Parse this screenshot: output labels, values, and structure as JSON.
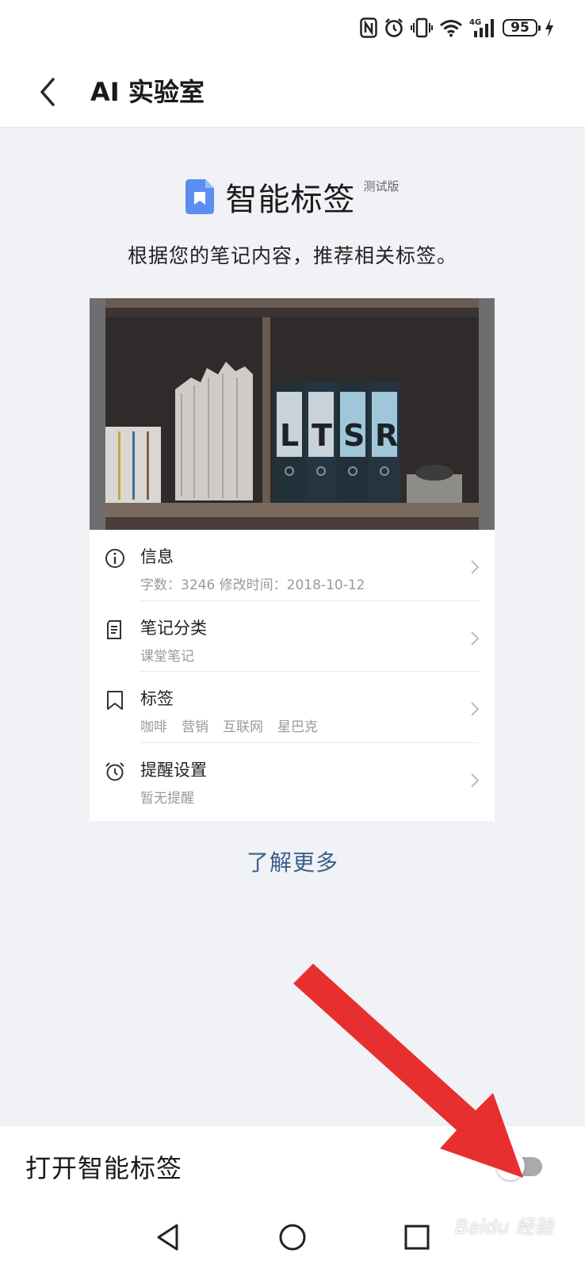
{
  "status_bar": {
    "icons": [
      "nfc-icon",
      "alarm-icon",
      "vibrate-icon",
      "wifi-icon",
      "signal-4g-icon",
      "battery-icon",
      "charging-icon"
    ],
    "network_label": "4G",
    "battery": "95"
  },
  "app_bar": {
    "back_icon": "chevron-left-icon",
    "title": "AI 实验室"
  },
  "feature": {
    "title": "智能标签",
    "badge": "测试版",
    "description": "根据您的笔记内容，推荐相关标签。",
    "icon": "bookmark-doc-icon",
    "accent_color": "#5b8ef0"
  },
  "preview": {
    "image_letters": [
      "L",
      "T",
      "S",
      "R"
    ],
    "rows": [
      {
        "icon": "info-icon",
        "title": "信息",
        "subtitle": "字数：3246    修改时间：2018-10-12"
      },
      {
        "icon": "notebook-icon",
        "title": "笔记分类",
        "subtitle": "课堂笔记"
      },
      {
        "icon": "bookmark-icon",
        "title": "标签",
        "tags": [
          "咖啡",
          "营销",
          "互联网",
          "星巴克"
        ]
      },
      {
        "icon": "alarm-clock-icon",
        "title": "提醒设置",
        "subtitle": "暂无提醒"
      }
    ]
  },
  "learn_more": "了解更多",
  "toggle": {
    "label": "打开智能标签",
    "enabled": false
  },
  "nav_bar": {
    "buttons": [
      "back-triangle-icon",
      "home-circle-icon",
      "recents-square-icon"
    ]
  },
  "watermark": "Baidu 经验"
}
